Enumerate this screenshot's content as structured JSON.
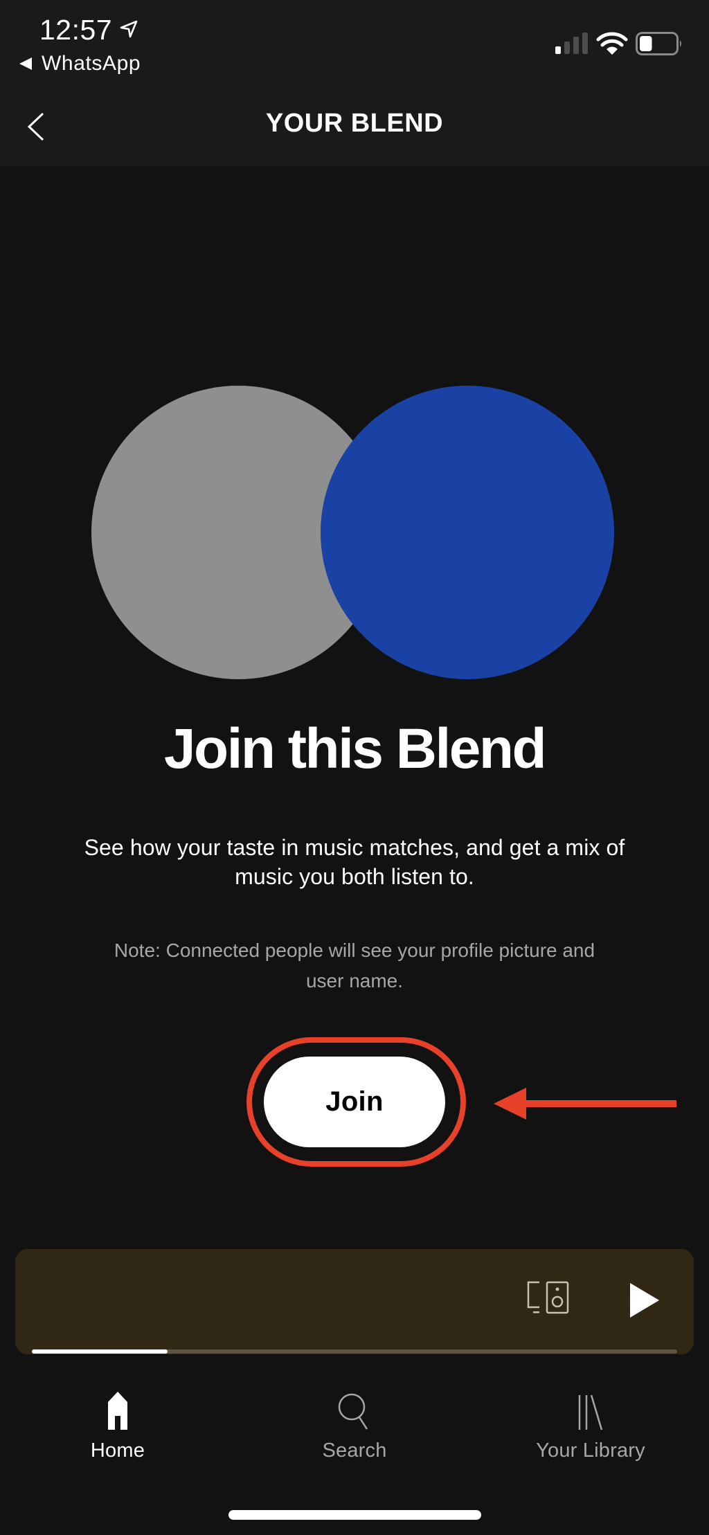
{
  "status_bar": {
    "time": "12:57",
    "back_app": "WhatsApp",
    "signal_bars_filled": 1,
    "signal_bars_total": 4,
    "battery_level": 0.35
  },
  "header": {
    "title": "YOUR BLEND"
  },
  "blend_art": {
    "left_circle_color": "#8f8f8f",
    "right_circle_color": "#1a42a4"
  },
  "main": {
    "title": "Join this Blend",
    "description": "See how your taste in music matches, and get a mix of music you both listen to.",
    "note": "Note: Connected people will see your profile picture and user name.",
    "join_button": "Join"
  },
  "annotation": {
    "highlight_color": "#e8412a"
  },
  "mini_player": {
    "progress": 0.21,
    "background": "#312715"
  },
  "tabs": [
    {
      "label": "Home",
      "icon": "home-icon",
      "active": true
    },
    {
      "label": "Search",
      "icon": "search-icon",
      "active": false
    },
    {
      "label": "Your Library",
      "icon": "library-icon",
      "active": false
    }
  ]
}
